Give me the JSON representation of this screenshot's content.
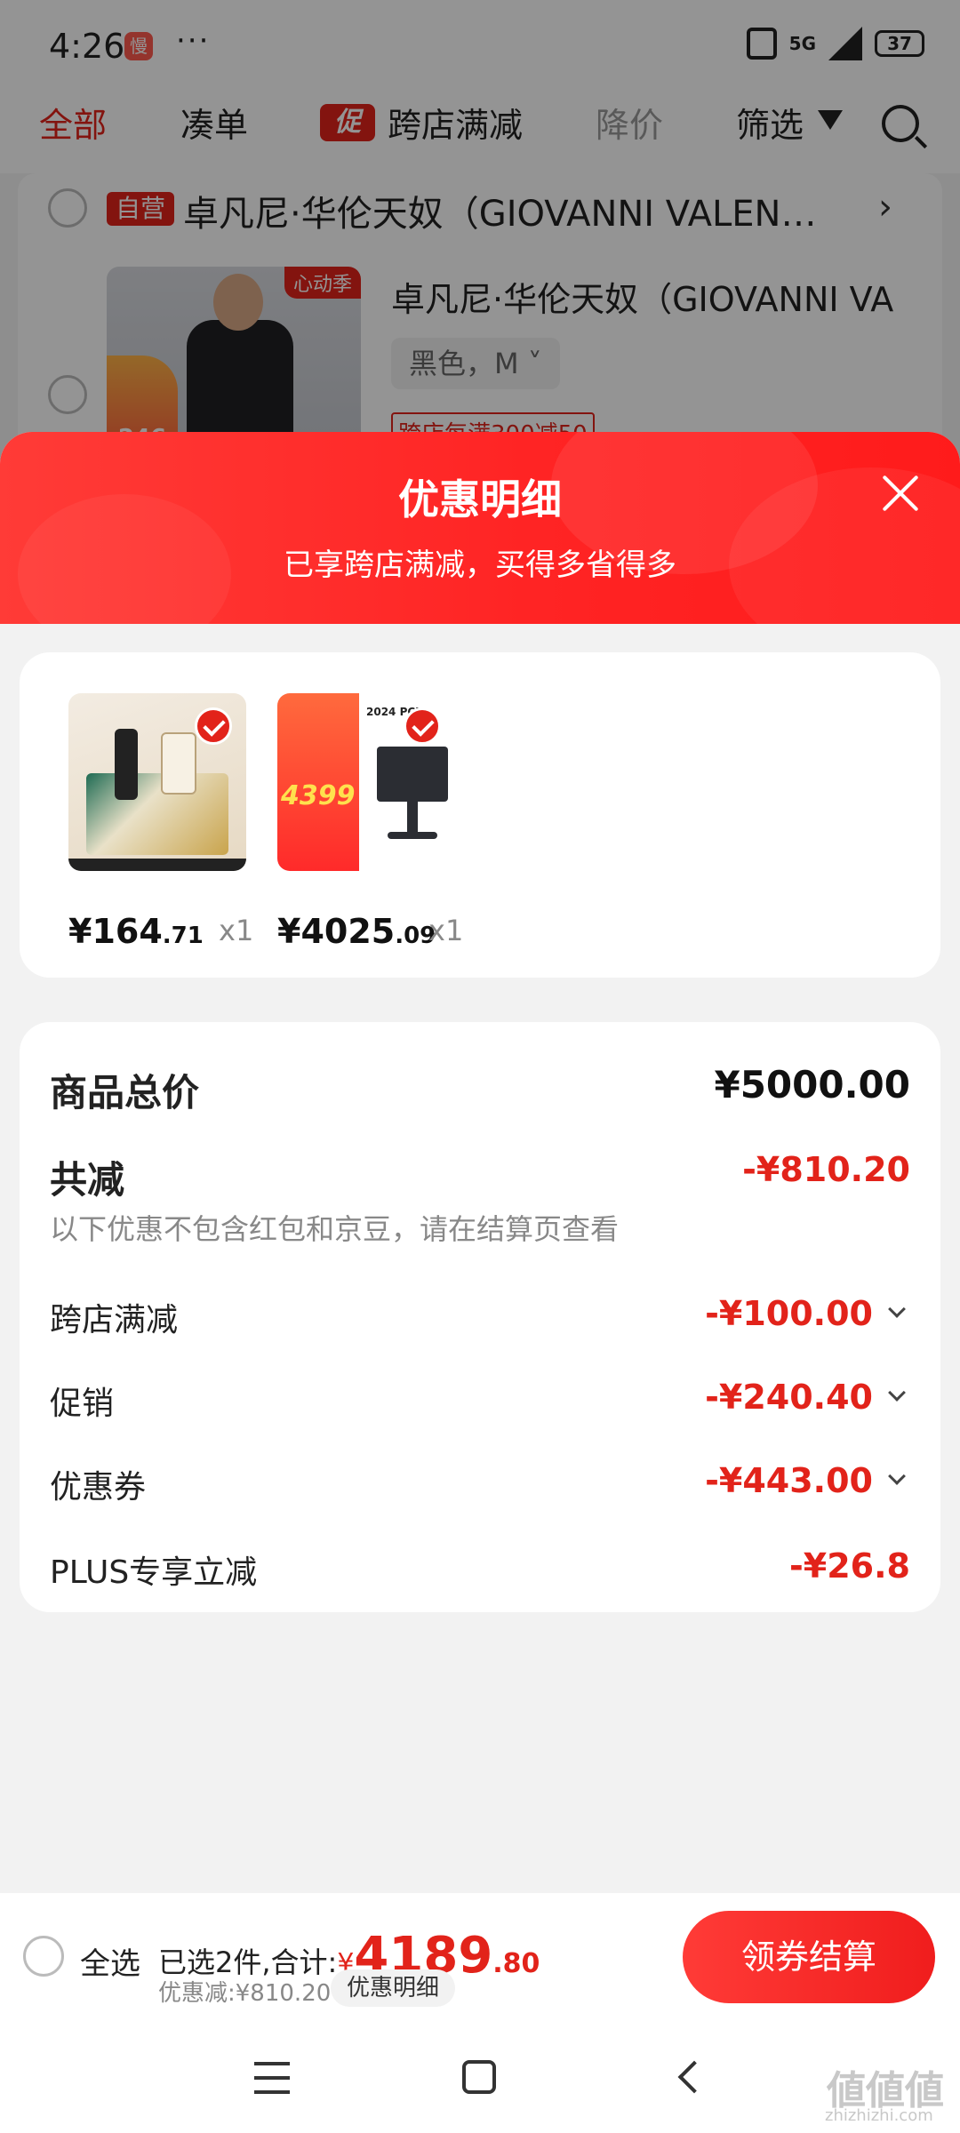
{
  "status_bar": {
    "time": "4:26",
    "app_badge": "慢",
    "dots": "···",
    "network": "5G",
    "battery": "37"
  },
  "tabs": {
    "all": "全部",
    "bundle": "凑单",
    "promo_tag": "促",
    "cross_store": "跨店满减",
    "price_drop": "降价",
    "filter": "筛选"
  },
  "shop": {
    "self_tag": "自营",
    "name": "卓凡尼·华伦天奴（GIOVANNI VALEN…",
    "arrow": "›",
    "product_title": "卓凡尼·华伦天奴（GIOVANNI VA",
    "product_spec": "黑色，M ˅",
    "product_badge": "心动季",
    "sale_number": "246",
    "promo_line": "跨店每满300减50"
  },
  "sheet": {
    "title": "优惠明细",
    "subtitle": "已享跨店满减，买得多省得多"
  },
  "items": [
    {
      "price_int": "¥164",
      "price_dec": ".71",
      "qty": "x1"
    },
    {
      "price_int": "¥4025",
      "price_dec": ".09",
      "qty": "x1",
      "ad_price": "4399",
      "ad_top": "2024 PCL"
    }
  ],
  "summary": {
    "total_label": "商品总价",
    "total_value": "¥5000.00",
    "reduce_label": "共减",
    "reduce_value": "-¥810.20",
    "note": "以下优惠不包含红包和京豆，请在结算页查看",
    "rows": [
      {
        "label": "跨店满减",
        "value": "-¥100.00"
      },
      {
        "label": "促销",
        "value": "-¥240.40"
      },
      {
        "label": "优惠券",
        "value": "-¥443.00"
      },
      {
        "label": "PLUS专享立减",
        "value": "-¥26.8"
      }
    ]
  },
  "checkout": {
    "select_all": "全选",
    "selected_text": "已选2件,合计:",
    "yen": "¥",
    "total_int": "4189",
    "total_dec": ".80",
    "discount_text": "优惠减:¥810.20",
    "detail_button": "优惠明细",
    "submit_button": "领券结算"
  },
  "watermark": {
    "text": "値値値",
    "sub": "zhizhizhi.com"
  },
  "colors": {
    "accent": "#e2231a",
    "header_gradient_start": "#ff3b37",
    "background": "#f2f2f2"
  }
}
